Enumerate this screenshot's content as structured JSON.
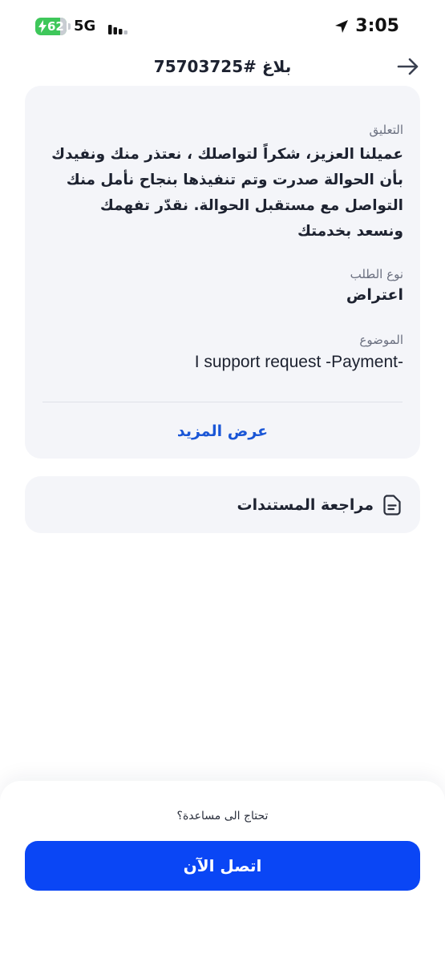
{
  "status_bar": {
    "battery_level": "62",
    "network": "5G",
    "time": "3:05"
  },
  "header": {
    "title": "بلاغ #75703725"
  },
  "details": {
    "comment_label": "التعليق",
    "comment_value": "عميلنا العزيز، شكراً لتواصلك ، نعتذر منك ونفيدك بأن الحوالة صدرت وتم تنفيذها بنجاح نأمل منك التواصل مع مستقبل الحوالة. نقدّر تفهمك ونسعد بخدمتك",
    "type_label": "نوع الطلب",
    "type_value": "اعتراض",
    "subject_label": "الموضوع",
    "subject_value": "I support request -Payment-",
    "show_more": "عرض المزيد"
  },
  "documents": {
    "label": "مراجعة المستندات"
  },
  "help": {
    "question": "تحتاج الى مساعدة؟",
    "call_button": "اتصل الآن"
  },
  "colors": {
    "accent": "#0a46f5",
    "link": "#1a56d6",
    "card_background": "#f4f5f9",
    "battery": "#3ec75a"
  },
  "icons": {
    "back": "arrow-right-icon",
    "documents": "document-icon",
    "location": "location-arrow-icon",
    "signal": "signal-bars-icon",
    "charging": "bolt-icon"
  }
}
